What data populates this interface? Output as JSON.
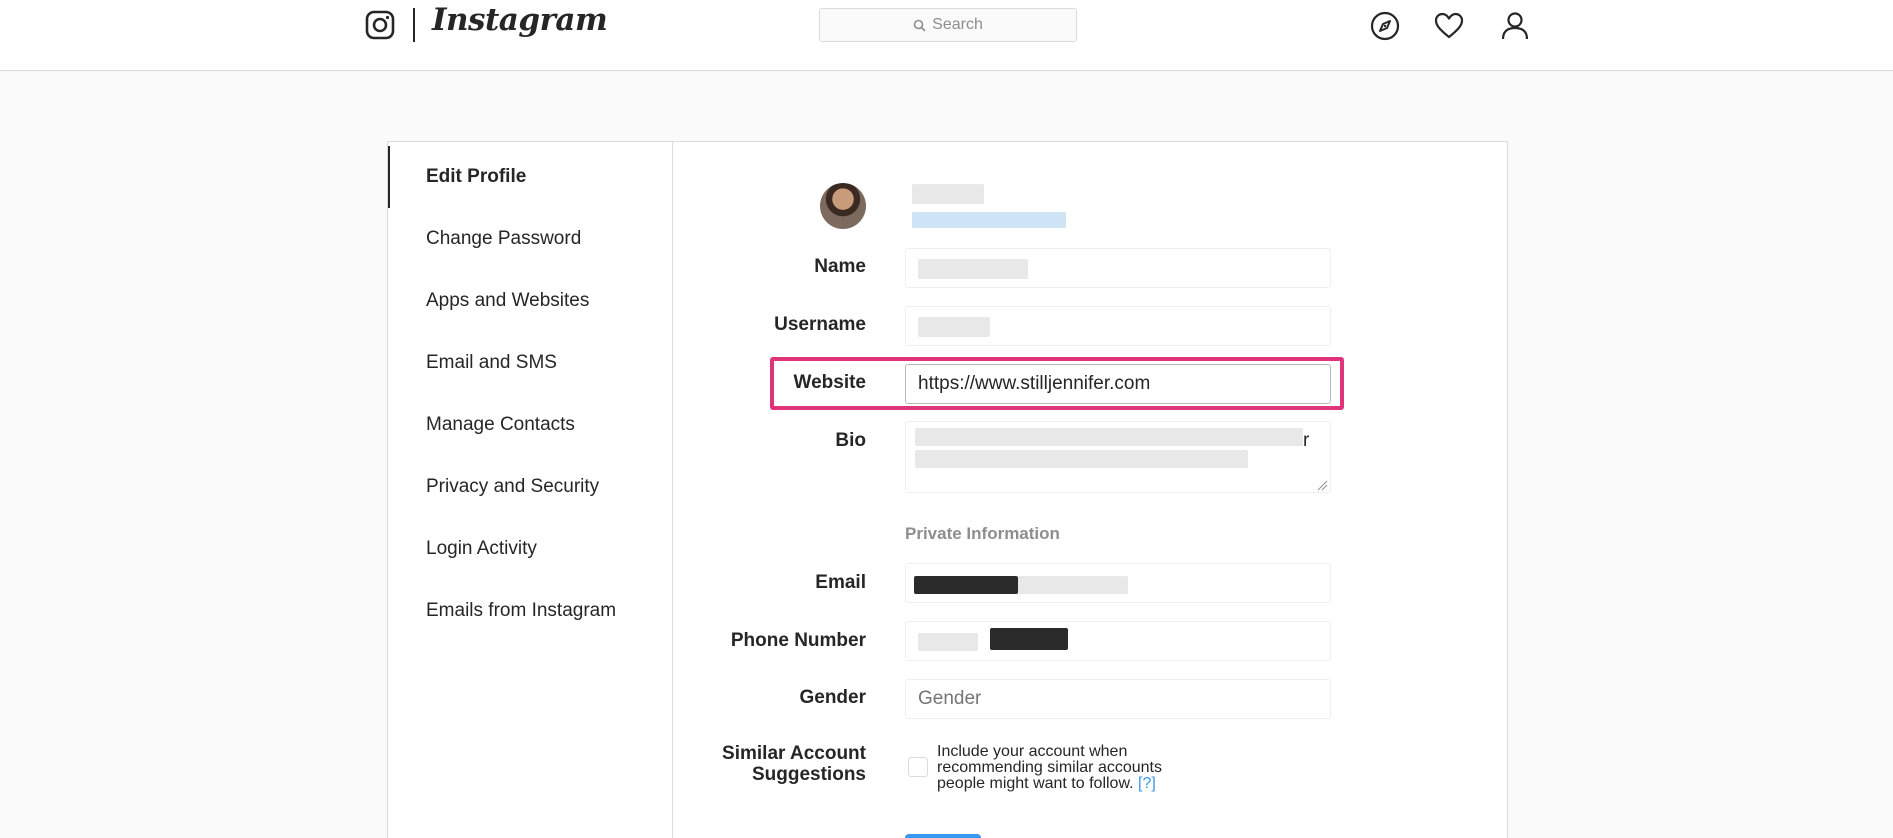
{
  "brand": {
    "wordmark": "Instagram"
  },
  "nav": {
    "search_placeholder": "Search",
    "icons": [
      "explore-icon",
      "heart-icon",
      "profile-icon"
    ]
  },
  "sidebar": {
    "items": [
      {
        "label": "Edit Profile",
        "active": true
      },
      {
        "label": "Change Password"
      },
      {
        "label": "Apps and Websites"
      },
      {
        "label": "Email and SMS"
      },
      {
        "label": "Manage Contacts"
      },
      {
        "label": "Privacy and Security"
      },
      {
        "label": "Login Activity"
      },
      {
        "label": "Emails from Instagram"
      }
    ]
  },
  "form": {
    "labels": {
      "name": "Name",
      "username": "Username",
      "website": "Website",
      "bio": "Bio",
      "email": "Email",
      "phone": "Phone Number",
      "gender": "Gender",
      "similar_line1": "Similar Account",
      "similar_line2": "Suggestions"
    },
    "website_value": "https://www.stilljennifer.com",
    "gender_placeholder": "Gender",
    "bio_visible_char": "r",
    "private_info_title": "Private Information",
    "similar_text": "Include your account when recommending similar accounts people might want to follow.",
    "help_link": "[?]"
  },
  "colors": {
    "highlight": "#e0347a",
    "link": "#3897f0",
    "border": "#dbdbdb",
    "muted": "#8e8e8e"
  }
}
